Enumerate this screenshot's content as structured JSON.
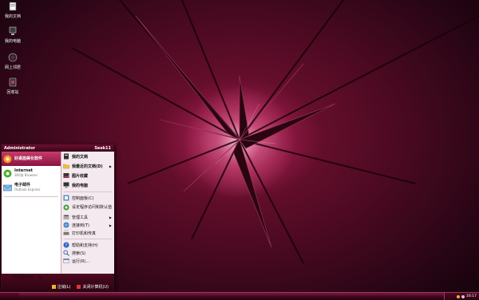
{
  "desktop_icons": [
    {
      "label": "我的文档",
      "icon": "my-documents-icon"
    },
    {
      "label": "我的电脑",
      "icon": "my-computer-icon"
    },
    {
      "label": "网上邻居",
      "icon": "network-icon"
    },
    {
      "label": "回收站",
      "icon": "recycle-bin-icon"
    }
  ],
  "start_menu": {
    "user_name": "Administrator",
    "header_right": "Seek11",
    "pinned": [
      {
        "name": "好桌面美化软件",
        "sub": "",
        "icon": "beautify-software-icon"
      },
      {
        "name": "Internet",
        "sub": "360安 Browser",
        "icon": "internet-browser-icon"
      },
      {
        "name": "电子邮件",
        "sub": "Outlook Express",
        "icon": "email-icon"
      }
    ],
    "all_programs": "所有程序(P)",
    "right_items": [
      {
        "label": "我的文档",
        "icon": "my-documents-icon",
        "bold": true,
        "submenu": false
      },
      {
        "label": "我最近的文档(D)",
        "icon": "recent-documents-icon",
        "bold": true,
        "submenu": true
      },
      {
        "label": "图片收藏",
        "icon": "pictures-icon",
        "bold": true,
        "submenu": false
      },
      {
        "label": "我的电脑",
        "icon": "my-computer-icon",
        "bold": true,
        "submenu": false
      },
      {
        "label": "控制面板(C)",
        "icon": "control-panel-icon",
        "bold": false,
        "submenu": false
      },
      {
        "label": "设定程序访问和默认值",
        "icon": "program-access-icon",
        "bold": false,
        "submenu": false
      },
      {
        "label": "管理工具",
        "icon": "admin-tools-icon",
        "bold": false,
        "submenu": true
      },
      {
        "label": "连接到(T)",
        "icon": "connect-to-icon",
        "bold": false,
        "submenu": true
      },
      {
        "label": "打印机和传真",
        "icon": "printer-icon",
        "bold": false,
        "submenu": false
      },
      {
        "label": "帮助和支持(H)",
        "icon": "help-icon",
        "bold": false,
        "submenu": false
      },
      {
        "label": "搜索(S)",
        "icon": "search-icon",
        "bold": false,
        "submenu": false
      },
      {
        "label": "运行(R)...",
        "icon": "run-icon",
        "bold": false,
        "submenu": false
      }
    ],
    "logoff_label": "注销(L)",
    "shutdown_label": "关闭计算机(U)"
  },
  "tray": {
    "clock": "16:17"
  },
  "colors": {
    "accent": "#8b1340",
    "taskbar": "#3b0619"
  }
}
